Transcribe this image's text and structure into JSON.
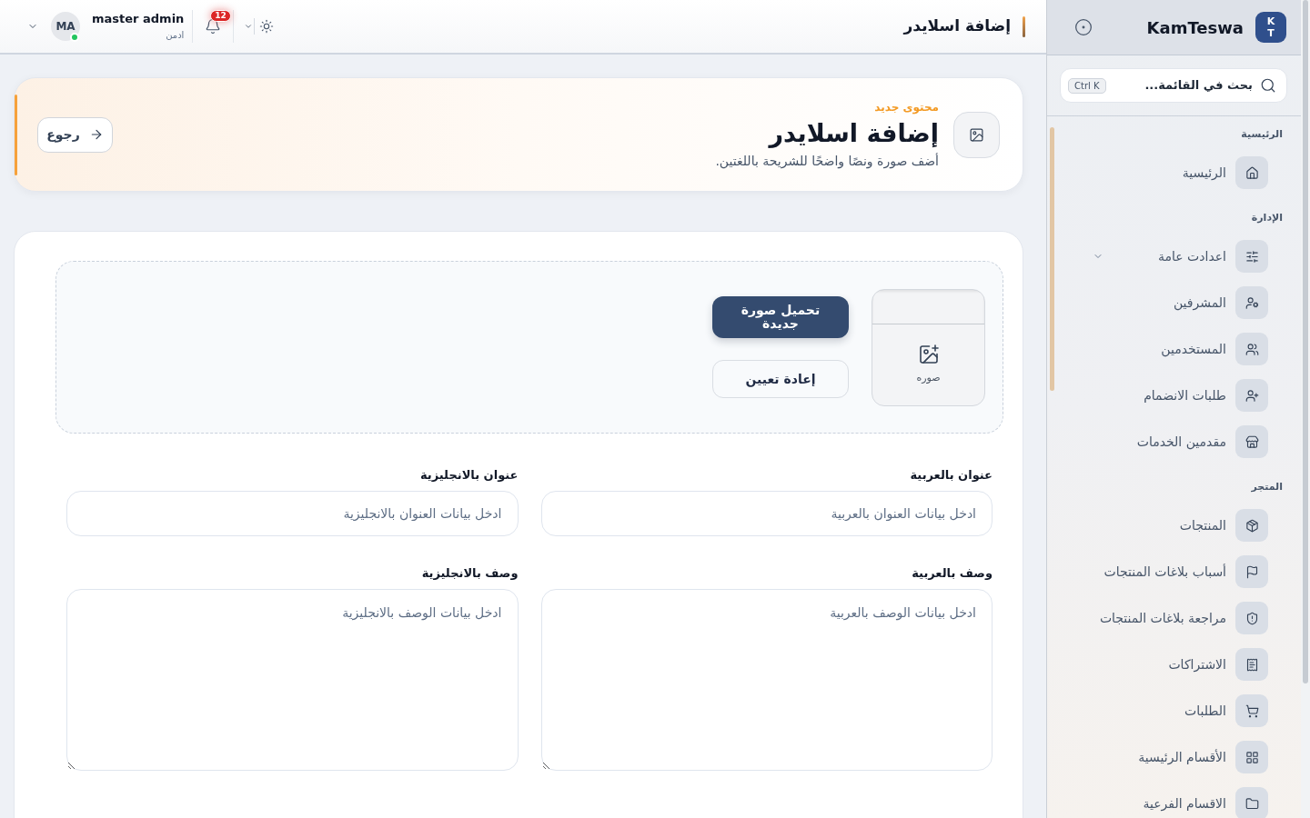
{
  "top_bar": {
    "title": "إضافة اسلايدر",
    "notifications": {
      "count": "12"
    },
    "user": {
      "initials": "MA",
      "name": "master admin",
      "role": "ادمن",
      "online": true
    }
  },
  "page_header": {
    "eyebrow": "محتوى جديد",
    "title": "إضافة اسلايدر",
    "subtitle": "أضف صورة ونصًا واضحًا للشريحة باللغتين.",
    "back_button": "رجوع"
  },
  "upload": {
    "image_label": "صوره",
    "upload_button": "تحميل صورة جديدة",
    "reset_button": "إعادة تعيين"
  },
  "fields": [
    {
      "kind": "input",
      "label": "عنوان بالعربية",
      "placeholder": "ادخل بيانات العنوان بالعربية"
    },
    {
      "kind": "input",
      "label": "عنوان بالانجليزية",
      "placeholder": "ادخل بيانات العنوان بالانجليزية"
    },
    {
      "kind": "textarea",
      "label": "وصف بالعربية",
      "placeholder": "ادخل بيانات الوصف بالعربية"
    },
    {
      "kind": "textarea",
      "label": "وصف بالانجليزية",
      "placeholder": "ادخل بيانات الوصف بالانجليزية"
    }
  ],
  "sidebar": {
    "brand": {
      "logo": [
        "K",
        "T"
      ],
      "name": "KamTeswa"
    },
    "search": {
      "placeholder": "بحث في القائمة...",
      "shortcut": "Ctrl K"
    },
    "sections": [
      {
        "title": "الرئيسية",
        "items": [
          {
            "kind": "link",
            "label": "الرئيسية"
          }
        ]
      },
      {
        "title": "الإدارة",
        "items": [
          {
            "kind": "group",
            "label": "اعدادت عامة"
          },
          {
            "kind": "link",
            "label": "المشرفين"
          },
          {
            "kind": "link",
            "label": "المستخدمين"
          },
          {
            "kind": "link",
            "label": "طلبات الانضمام"
          },
          {
            "kind": "link",
            "label": "مقدمين الخدمات"
          }
        ]
      },
      {
        "title": "المتجر",
        "items": [
          {
            "kind": "link",
            "label": "المنتجات"
          },
          {
            "kind": "link",
            "label": "أسباب بلاغات المنتجات"
          },
          {
            "kind": "link",
            "label": "مراجعة بلاغات المنتجات"
          },
          {
            "kind": "link",
            "label": "الاشتراكات"
          },
          {
            "kind": "link",
            "label": "الطلبات"
          },
          {
            "kind": "link",
            "label": "الأقسام الرئيسية"
          },
          {
            "kind": "link",
            "label": "الاقسام الفرعية"
          }
        ]
      }
    ]
  }
}
